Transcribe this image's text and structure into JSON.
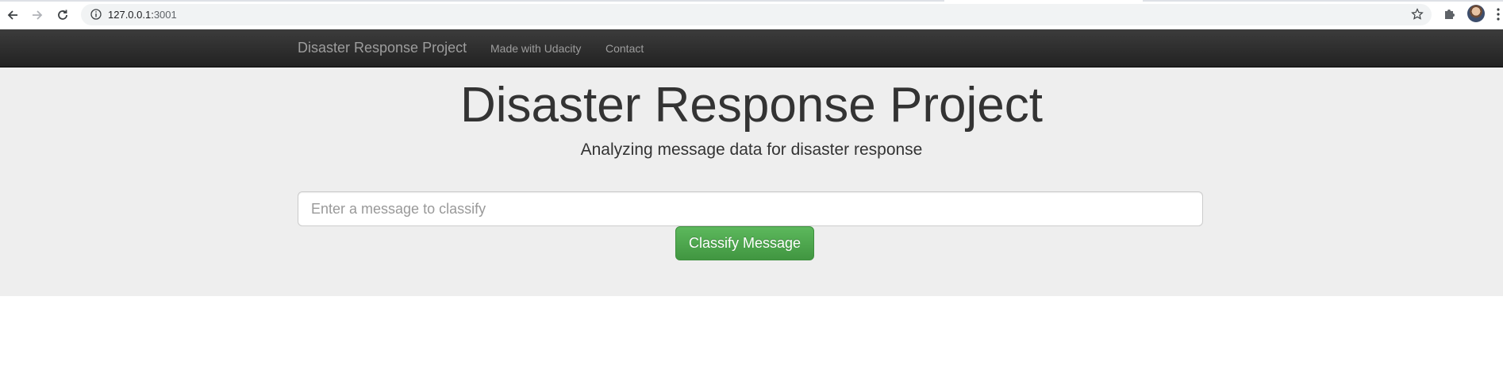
{
  "browser": {
    "url_host": "127.0.0.1:",
    "url_port": "3001"
  },
  "navbar": {
    "brand": "Disaster Response Project",
    "links": [
      {
        "label": "Made with Udacity"
      },
      {
        "label": "Contact"
      }
    ],
    "colors": {
      "background": "#222222",
      "text": "#9d9d9d"
    }
  },
  "main": {
    "title": "Disaster Response Project",
    "subtitle": "Analyzing message data for disaster response",
    "message_input": {
      "value": "",
      "placeholder": "Enter a message to classify"
    },
    "classify_button": "Classify Message",
    "colors": {
      "jumbotron": "#eeeeee",
      "button": "#5cb85c"
    }
  },
  "icons": [
    "back-arrow-icon",
    "forward-arrow-icon",
    "reload-icon",
    "info-icon",
    "star-icon",
    "puzzle-icon",
    "avatar",
    "menu-dots-icon"
  ]
}
